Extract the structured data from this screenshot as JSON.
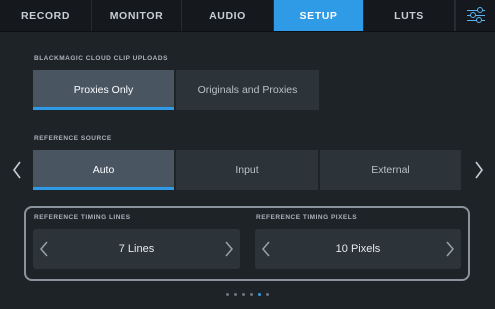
{
  "tabs": [
    {
      "label": "RECORD",
      "active": false
    },
    {
      "label": "MONITOR",
      "active": false
    },
    {
      "label": "AUDIO",
      "active": false
    },
    {
      "label": "SETUP",
      "active": true
    },
    {
      "label": "LUTS",
      "active": false
    }
  ],
  "cloud_uploads": {
    "label": "BLACKMAGIC CLOUD CLIP UPLOADS",
    "options": [
      "Proxies Only",
      "Originals and Proxies"
    ],
    "selected": "Proxies Only"
  },
  "reference_source": {
    "label": "REFERENCE SOURCE",
    "options": [
      "Auto",
      "Input",
      "External"
    ],
    "selected": "Auto"
  },
  "timing_lines": {
    "label": "REFERENCE TIMING LINES",
    "value": "7 Lines"
  },
  "timing_pixels": {
    "label": "REFERENCE TIMING PIXELS",
    "value": "10 Pixels"
  },
  "pagination": {
    "total": 6,
    "current": 5
  },
  "colors": {
    "accent": "#2f9ae6",
    "background": "#1e2328",
    "tabbar": "#15191d"
  },
  "icons": {
    "menu": "settings-sliders-icon",
    "prev": "chevron-left-icon",
    "next": "chevron-right-icon"
  }
}
